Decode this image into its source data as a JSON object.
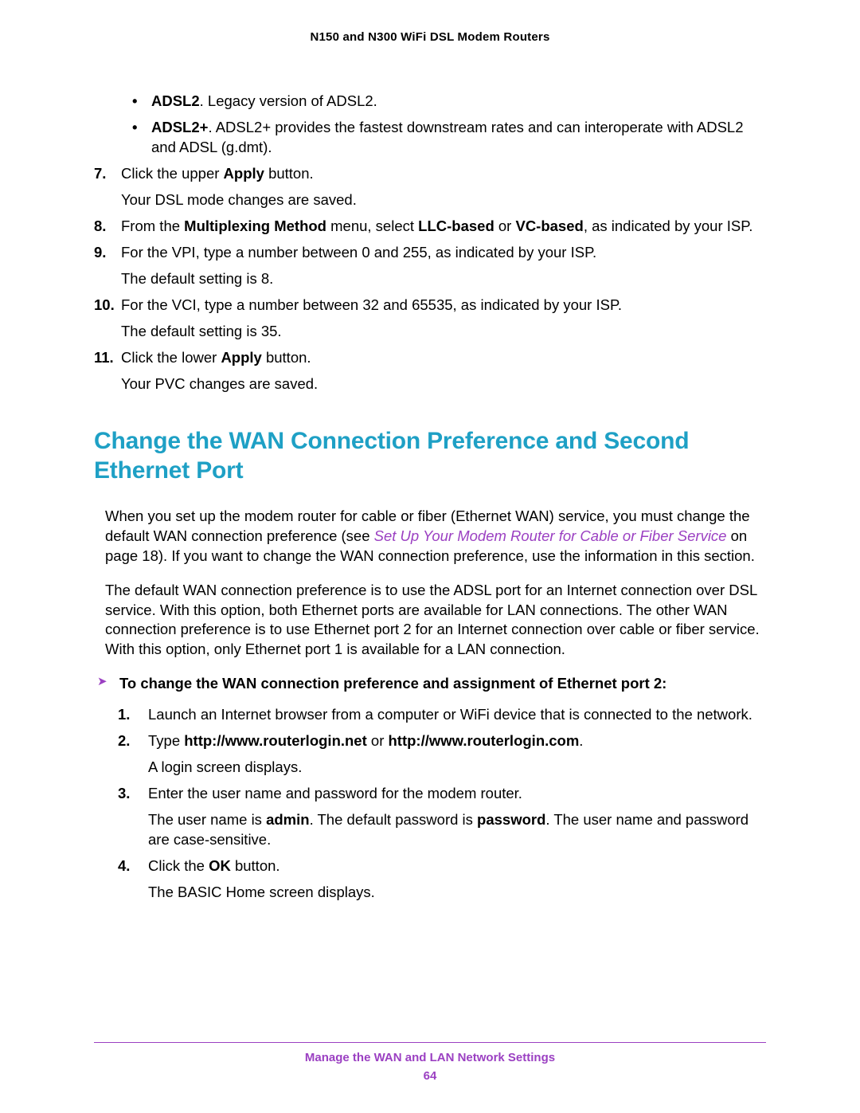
{
  "header": "N150 and N300 WiFi DSL Modem Routers",
  "bullets": [
    {
      "bold": "ADSL2",
      "text": ". Legacy version of ADSL2."
    },
    {
      "bold": "ADSL2+",
      "text": ". ADSL2+ provides the fastest downstream rates and can interoperate with ADSL2 and ADSL (g.dmt)."
    }
  ],
  "steps": [
    {
      "num": "7.",
      "parts": [
        {
          "t": "Click the upper "
        },
        {
          "t": "Apply",
          "b": true
        },
        {
          "t": " button."
        }
      ],
      "after": "Your DSL mode changes are saved."
    },
    {
      "num": "8.",
      "parts": [
        {
          "t": "From the "
        },
        {
          "t": "Multiplexing Method",
          "b": true
        },
        {
          "t": " menu, select "
        },
        {
          "t": "LLC-based",
          "b": true
        },
        {
          "t": " or "
        },
        {
          "t": "VC-based",
          "b": true
        },
        {
          "t": ", as indicated by your ISP."
        }
      ]
    },
    {
      "num": "9.",
      "parts": [
        {
          "t": "For the VPI, type a number between 0 and 255, as indicated by your ISP."
        }
      ],
      "after": "The default setting is 8."
    },
    {
      "num": "10.",
      "parts": [
        {
          "t": "For the VCI, type a number between 32 and 65535, as indicated by your ISP."
        }
      ],
      "after": "The default setting is 35."
    },
    {
      "num": "11.",
      "parts": [
        {
          "t": "Click the lower "
        },
        {
          "t": "Apply",
          "b": true
        },
        {
          "t": " button."
        }
      ],
      "after": "Your PVC changes are saved."
    }
  ],
  "section_title": "Change the WAN Connection Preference and Second Ethernet Port",
  "para1": {
    "pre": "When you set up the modem router for cable or fiber (Ethernet WAN) service, you must change the default WAN connection preference (see ",
    "link": "Set Up Your Modem Router for Cable or Fiber Service",
    "post": " on page 18). If you want to change the WAN connection preference, use the information in this section."
  },
  "para2": "The default WAN connection preference is to use the ADSL port for an Internet connection over DSL service. With this option, both Ethernet ports are available for LAN connections. The other WAN connection preference is to use Ethernet port 2 for an Internet connection over cable or fiber service. With this option, only Ethernet port 1 is available for a LAN connection.",
  "procedure_title": "To change the WAN connection preference and assignment of Ethernet port 2:",
  "procedure": [
    {
      "num": "1.",
      "parts": [
        {
          "t": "Launch an Internet browser from a computer or WiFi device that is connected to the network."
        }
      ]
    },
    {
      "num": "2.",
      "parts": [
        {
          "t": "Type "
        },
        {
          "t": "http://www.routerlogin.net",
          "b": true
        },
        {
          "t": " or "
        },
        {
          "t": "http://www.routerlogin.com",
          "b": true
        },
        {
          "t": "."
        }
      ],
      "after": "A login screen displays."
    },
    {
      "num": "3.",
      "parts": [
        {
          "t": "Enter the user name and password for the modem router."
        }
      ],
      "after_parts": [
        {
          "t": "The user name is "
        },
        {
          "t": "admin",
          "b": true
        },
        {
          "t": ". The default password is "
        },
        {
          "t": "password",
          "b": true
        },
        {
          "t": ". The user name and password are case-sensitive."
        }
      ]
    },
    {
      "num": "4.",
      "parts": [
        {
          "t": "Click the "
        },
        {
          "t": "OK",
          "b": true
        },
        {
          "t": " button."
        }
      ],
      "after": "The BASIC Home screen displays."
    }
  ],
  "footer": {
    "title": "Manage the WAN and LAN Network Settings",
    "page": "64"
  }
}
